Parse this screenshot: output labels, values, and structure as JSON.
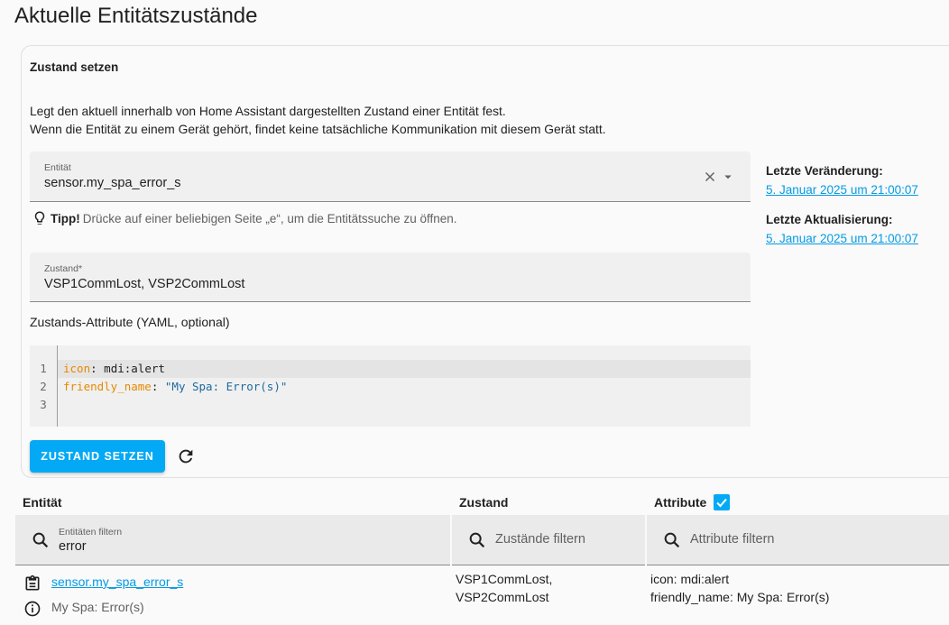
{
  "page": {
    "title": "Aktuelle Entitätszustände"
  },
  "set_state": {
    "title": "Zustand setzen",
    "description_line1": "Legt den aktuell innerhalb von Home Assistant dargestellten Zustand einer Entität fest.",
    "description_line2": "Wenn die Entität zu einem Gerät gehört, findet keine tatsächliche Kommunikation mit diesem Gerät statt.",
    "entity_label": "Entität",
    "entity_value": "sensor.my_spa_error_s",
    "tip_bold": "Tipp!",
    "tip_text": "Drücke auf einer beliebigen Seite „e“, um die Entitätssuche zu öffnen.",
    "state_label": "Zustand*",
    "state_value": "VSP1CommLost, VSP2CommLost",
    "attributes_label": "Zustands-Attribute (YAML, optional)",
    "code": {
      "line_numbers": [
        "1",
        "2",
        "3"
      ],
      "line1_key": "icon",
      "line1_sep": ": ",
      "line1_value": "mdi:alert",
      "line2_key": "friendly_name",
      "line2_sep": ": ",
      "line2_value": "\"My Spa: Error(s)\""
    },
    "button_label": "ZUSTAND SETZEN"
  },
  "side": {
    "last_changed_label": "Letzte Veränderung:",
    "last_changed_value": "5. Januar 2025 um 21:00:07",
    "last_updated_label": "Letzte Aktualisierung:",
    "last_updated_value": "5. Januar 2025 um 21:00:07"
  },
  "table": {
    "columns": [
      "Entität",
      "Zustand",
      "Attribute"
    ],
    "attributes_checked": true,
    "filters": {
      "entity_label": "Entitäten filtern",
      "entity_value": "error",
      "state_placeholder": "Zustände filtern",
      "attribute_placeholder": "Attribute filtern"
    },
    "rows": [
      {
        "entity_id": "sensor.my_spa_error_s",
        "friendly_name": "My Spa: Error(s)",
        "state_line1": "VSP1CommLost,",
        "state_line2": "VSP2CommLost",
        "attr_line1": "icon: mdi:alert",
        "attr_line2": "friendly_name: My Spa: Error(s)"
      }
    ]
  },
  "colors": {
    "accent": "#03a9f4",
    "link": "#039be5"
  },
  "icons": [
    "close-icon",
    "chevron-down-icon",
    "lightbulb-icon",
    "refresh-icon",
    "search-icon",
    "clipboard-icon",
    "info-icon",
    "checkbox-icon"
  ]
}
